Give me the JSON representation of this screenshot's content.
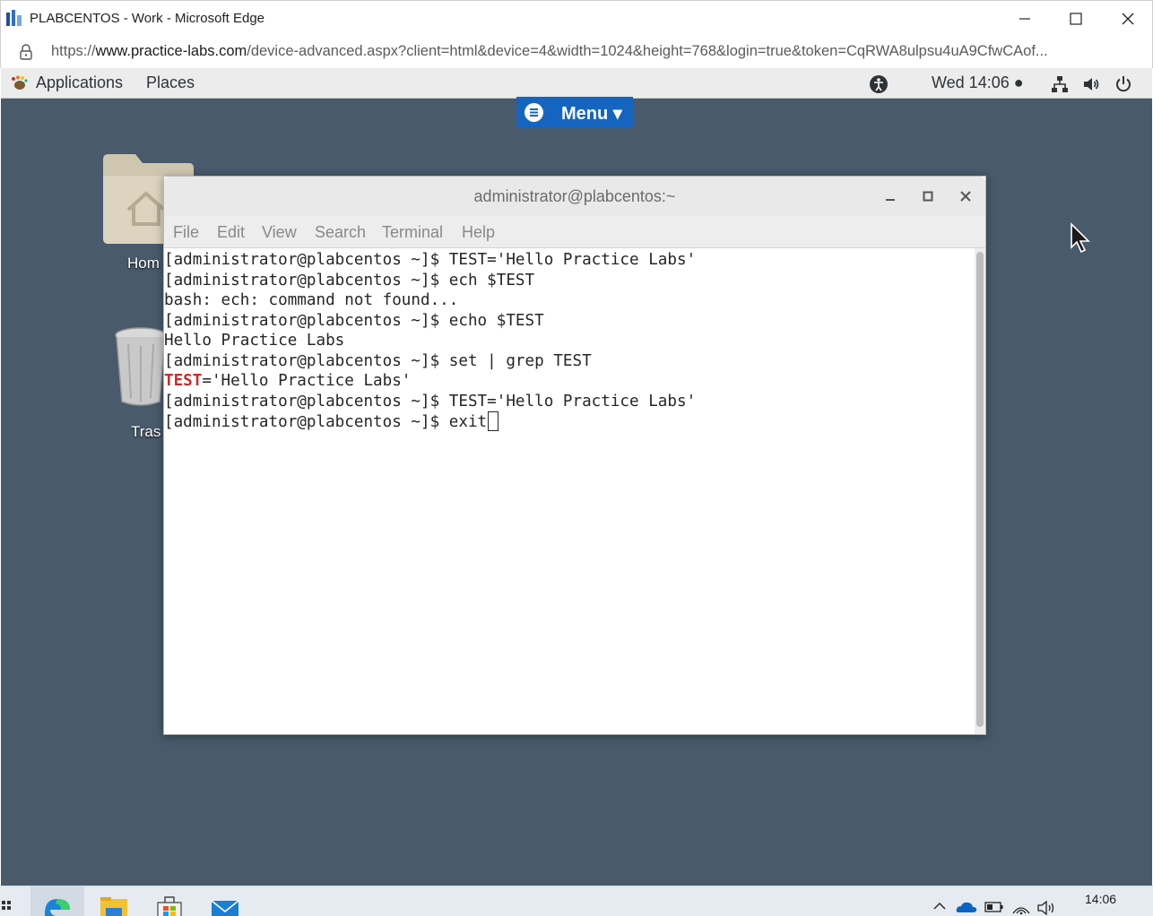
{
  "browser": {
    "title": "PLABCENTOS - Work - Microsoft Edge",
    "url_prefix": "https://",
    "url_host": "www.practice-labs.com",
    "url_rest": "/device-advanced.aspx?client=html&device=4&width=1024&height=768&login=true&token=CqRWA8ulpsu4uA9CfwCAof..."
  },
  "gnome": {
    "applications": "Applications",
    "places": "Places",
    "clock": "Wed 14:06 ●"
  },
  "menu_button": "Menu ▾",
  "desktop": {
    "home_label": "Hom",
    "trash_label": "Tras"
  },
  "terminal": {
    "title": "administrator@plabcentos:~",
    "menu": [
      "File",
      "Edit",
      "View",
      "Search",
      "Terminal",
      "Help"
    ],
    "lines": [
      "[administrator@plabcentos ~]$ TEST='Hello Practice Labs'",
      "[administrator@plabcentos ~]$ ech $TEST",
      "bash: ech: command not found...",
      "[administrator@plabcentos ~]$ echo $TEST",
      "Hello Practice Labs",
      "[administrator@plabcentos ~]$ set | grep TEST",
      "='Hello Practice Labs'",
      "[administrator@plabcentos ~]$ TEST='Hello Practice Labs'",
      "[administrator@plabcentos ~]$ exit"
    ],
    "highlight_word": "TEST"
  },
  "taskbar": {
    "clock": "14:06"
  },
  "colors": {
    "desktop": "#485a6c",
    "menu_button": "#1565c0",
    "grep_match": "#cc2a2a"
  }
}
